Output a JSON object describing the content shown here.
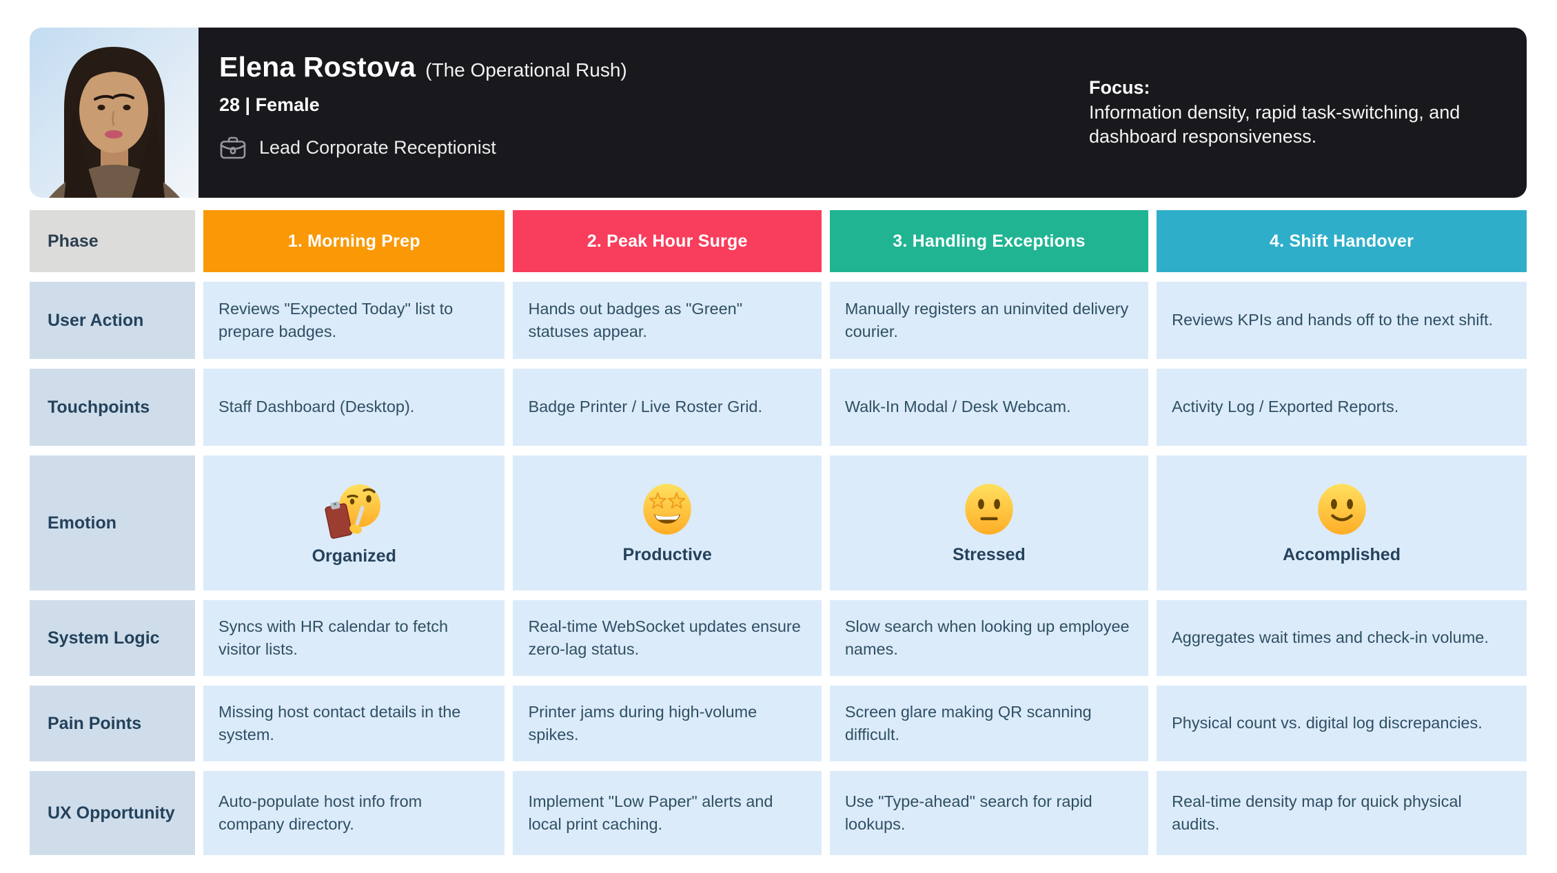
{
  "persona": {
    "name": "Elena Rostova",
    "archetype": "(The Operational Rush)",
    "demographics": "28 | Female",
    "role": "Lead Corporate Receptionist",
    "role_icon": "briefcase-icon",
    "photo_icon": "persona-portrait",
    "focus_label": "Focus:",
    "focus_text": "Information density, rapid task-switching, and dashboard responsiveness."
  },
  "row_headers": {
    "phase": "Phase",
    "user_action": "User Action",
    "touchpoints": "Touchpoints",
    "emotion": "Emotion",
    "system_logic": "System Logic",
    "pain_points": "Pain Points",
    "ux_opportunity": "UX Opportunity"
  },
  "phases": [
    {
      "title": "1. Morning Prep",
      "color": "#fa9805",
      "user_action": "Reviews \"Expected Today\" list to prepare badges.",
      "touchpoints": "Staff Dashboard (Desktop).",
      "emotion_label": "Organized",
      "emotion_icon": "raised-eyebrow-clipboard-emoji",
      "system_logic": "Syncs with HR calendar to fetch visitor lists.",
      "pain_points": "Missing host contact details in the system.",
      "ux_opportunity": "Auto-populate host info from company directory."
    },
    {
      "title": "2. Peak Hour Surge",
      "color": "#f93d5c",
      "user_action": "Hands out badges as \"Green\" statuses appear.",
      "touchpoints": "Badge Printer / Live Roster Grid.",
      "emotion_label": "Productive",
      "emotion_icon": "star-struck-emoji",
      "system_logic": "Real-time WebSocket updates ensure zero-lag status.",
      "pain_points": "Printer jams during high-volume spikes.",
      "ux_opportunity": "Implement \"Low Paper\" alerts and local print caching."
    },
    {
      "title": "3. Handling Exceptions",
      "color": "#20b492",
      "user_action": "Manually registers an uninvited delivery courier.",
      "touchpoints": "Walk-In Modal / Desk Webcam.",
      "emotion_label": "Stressed",
      "emotion_icon": "neutral-face-emoji",
      "system_logic": "Slow search when looking up employee names.",
      "pain_points": "Screen glare making QR scanning difficult.",
      "ux_opportunity": "Use \"Type-ahead\" search for rapid lookups."
    },
    {
      "title": "4. Shift Handover",
      "color": "#2faec9",
      "user_action": "Reviews KPIs and hands off to the next shift.",
      "touchpoints": "Activity Log / Exported Reports.",
      "emotion_label": "Accomplished",
      "emotion_icon": "slightly-smiling-face-emoji",
      "system_logic": "Aggregates wait times and check-in volume.",
      "pain_points": "Physical count vs. digital log discrepancies.",
      "ux_opportunity": "Real-time density map for quick physical audits."
    }
  ],
  "colors": {
    "header_background": "#18181d",
    "label_cell": "#cfddeb",
    "phase_label_cell": "#dcdcda",
    "content_cell": "#dcebfa",
    "body_text": "#2e5063",
    "label_text": "#24425b"
  }
}
